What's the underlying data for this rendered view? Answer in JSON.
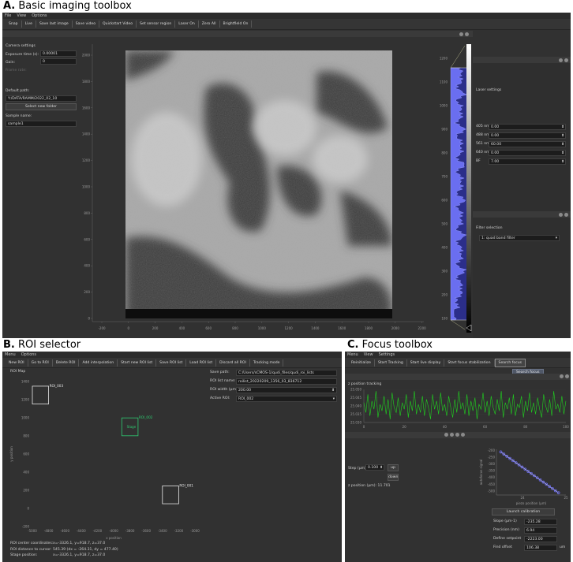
{
  "titleA": {
    "letter": "A.",
    "text": "Basic imaging toolbox"
  },
  "titleB": {
    "letter": "B.",
    "text": "ROI selector"
  },
  "titleC": {
    "letter": "C.",
    "text": "Focus toolbox"
  },
  "a": {
    "menu": [
      "File",
      "View",
      "Options"
    ],
    "toolbar": [
      "Snap",
      "Live",
      "Save last image",
      "Save video",
      "Quickstart Video",
      "Set sensor region",
      "Laser On",
      "Zero All",
      "Brightfield On"
    ],
    "camera_settings": "Camera settings",
    "exposure_label": "Exposure time (s):",
    "exposure_value": "0.00001",
    "gain_label": "Gain:",
    "gain_value": "0",
    "frame_label": "Frame rate:",
    "frame_value": "",
    "default_path_label": "Default path:",
    "default_path_value": "Y:/DATA/RAMM/2022_02_10",
    "select_folder": "Select new folder",
    "sample_label": "Sample name:",
    "sample_value": "sample1",
    "image_yticks": [
      "2000",
      "1800",
      "1600",
      "1400",
      "1200",
      "1000",
      "800",
      "600",
      "400",
      "200",
      "0"
    ],
    "image_xticks": [
      "-200",
      "0",
      "200",
      "400",
      "600",
      "800",
      "1000",
      "1200",
      "1400",
      "1600",
      "1800",
      "2000",
      "2200"
    ],
    "hist_ticks": [
      "1200",
      "1100",
      "1000",
      "900",
      "800",
      "700",
      "600",
      "500",
      "400",
      "300",
      "200",
      "100"
    ],
    "laser_title": "Laser settings",
    "lasers": [
      {
        "label": "405 nm",
        "value": "0.00"
      },
      {
        "label": "488 nm",
        "value": "0.00"
      },
      {
        "label": "561 nm",
        "value": "60.00"
      },
      {
        "label": "640 nm",
        "value": "0.00"
      },
      {
        "label": "BF",
        "value": "7.00"
      }
    ],
    "filter_title": "Filter selection",
    "filter_value": "1: quad band filter"
  },
  "b": {
    "menu": [
      "Menu",
      "Options"
    ],
    "toolbar": [
      "New ROI",
      "Go to ROI",
      "Delete ROI",
      "Add interpolation",
      "Start new ROI list",
      "Save ROI list",
      "Load ROI list",
      "Discard all ROI",
      "Tracking mode"
    ],
    "map_label": "ROI Map",
    "form": [
      {
        "label": "Save path:",
        "value": "C:/Users/sCMOS-1/qudi_files/qudi_roi_lists"
      },
      {
        "label": "ROI list name:",
        "value": "roilist_20220209_1356_03_836712"
      },
      {
        "label": "ROI width (µm):",
        "value": "200.00"
      },
      {
        "label": "Active ROI:",
        "value": "ROI_002"
      }
    ],
    "rois": [
      {
        "name": "ROI_003",
        "x": -4900,
        "y": 1250
      },
      {
        "name": "ROI_002",
        "x": -3800,
        "y": 900
      },
      {
        "name": "ROI_001",
        "x": -3300,
        "y": 150
      }
    ],
    "stage_label": "Stage",
    "xticks": [
      "-5000",
      "-4800",
      "-4600",
      "-4400",
      "-4200",
      "-4000",
      "-3800",
      "-3600",
      "-3400",
      "-3200",
      "-3000"
    ],
    "yticks": [
      "1400",
      "1200",
      "1000",
      "800",
      "600",
      "400",
      "200",
      "0",
      "-200"
    ],
    "xlabel": "x position",
    "ylabel": "y position",
    "status": [
      {
        "label": "ROI center coordinates:",
        "value": "x=-3326.1, y=918.7, z=37.0"
      },
      {
        "label": "ROI distance to cursor:",
        "value": "545.39 (dx = -264.31, dy = 477.40)"
      },
      {
        "label": "Stage position:",
        "value": "x=-3326.1, y=918.7, z=37.0"
      }
    ]
  },
  "c": {
    "menu": [
      "Menu",
      "View",
      "Settings"
    ],
    "toolbar": [
      "Reinitialize",
      "Start Tracking",
      "Start live display",
      "Start focus stabilization",
      "Search focus"
    ],
    "tooltip": "Search focus",
    "trace_title": "z position tracking",
    "trace_yticks": [
      "25.050",
      "25.045",
      "25.040",
      "25.035",
      "25.030"
    ],
    "trace_xticks": [
      "0",
      "20",
      "40",
      "60",
      "80",
      "100"
    ],
    "trace_values": [
      25.042,
      25.036,
      25.047,
      25.034,
      25.043,
      25.038,
      25.049,
      25.033,
      25.041,
      25.037,
      25.046,
      25.035,
      25.044,
      25.032,
      25.048,
      25.039,
      25.036,
      25.045,
      25.034,
      25.042,
      25.038,
      25.047,
      25.033,
      25.043,
      25.037,
      25.049,
      25.035,
      25.041,
      25.036,
      25.046,
      25.034,
      25.044,
      25.039,
      25.032,
      25.047,
      25.038,
      25.043,
      25.035,
      25.048,
      25.037,
      25.041,
      25.034,
      25.046,
      25.039,
      25.033,
      25.044,
      25.036,
      25.049,
      25.038,
      25.042,
      25.035,
      25.047,
      25.034,
      25.043,
      25.037,
      25.045,
      25.032,
      25.041,
      25.038,
      25.048,
      25.036,
      25.043,
      25.034,
      25.046,
      25.039,
      25.035,
      25.044,
      25.037,
      25.049,
      25.033,
      25.042,
      25.038,
      25.045,
      25.035,
      25.047,
      25.034,
      25.041,
      25.039,
      25.046,
      25.033,
      25.043,
      25.037,
      25.048,
      25.036,
      25.042,
      25.035,
      25.045,
      25.038,
      25.033,
      25.047,
      25.04,
      25.036,
      25.044,
      25.034,
      25.049,
      25.038,
      25.041,
      25.036,
      25.046,
      25.035,
      25.043
    ],
    "step_label": "Step (µm)",
    "step_value": "0.100",
    "up": "up",
    "down": "down",
    "zpos": "z position (µm): 11.701",
    "calib_xlabel": "piezo position (µm)",
    "calib_ylabel": "autofocus signal",
    "calib_xticks": [
      "24",
      "25"
    ],
    "calib_yticks": [
      "-200",
      "-250",
      "-300",
      "-350",
      "-400",
      "-450",
      "-500"
    ],
    "calib_points": [
      [
        23.5,
        -210
      ],
      [
        23.57,
        -226
      ],
      [
        23.64,
        -242
      ],
      [
        23.71,
        -258
      ],
      [
        23.78,
        -274
      ],
      [
        23.85,
        -290
      ],
      [
        23.92,
        -306
      ],
      [
        23.99,
        -322
      ],
      [
        24.06,
        -338
      ],
      [
        24.13,
        -354
      ],
      [
        24.2,
        -370
      ],
      [
        24.27,
        -386
      ],
      [
        24.34,
        -402
      ],
      [
        24.41,
        -418
      ],
      [
        24.48,
        -434
      ],
      [
        24.55,
        -450
      ],
      [
        24.62,
        -466
      ],
      [
        24.69,
        -482
      ],
      [
        24.76,
        -498
      ],
      [
        24.83,
        -514
      ]
    ],
    "launch": "Launch calibration",
    "results": [
      {
        "label": "Slope (µm-1)",
        "value": "-235.28"
      },
      {
        "label": "Precision (nm)",
        "value": "6.94"
      },
      {
        "label": "Define setpoint",
        "value": "-2223.00"
      },
      {
        "label": "Find offset",
        "value": "106.38"
      }
    ],
    "unit": "um"
  }
}
